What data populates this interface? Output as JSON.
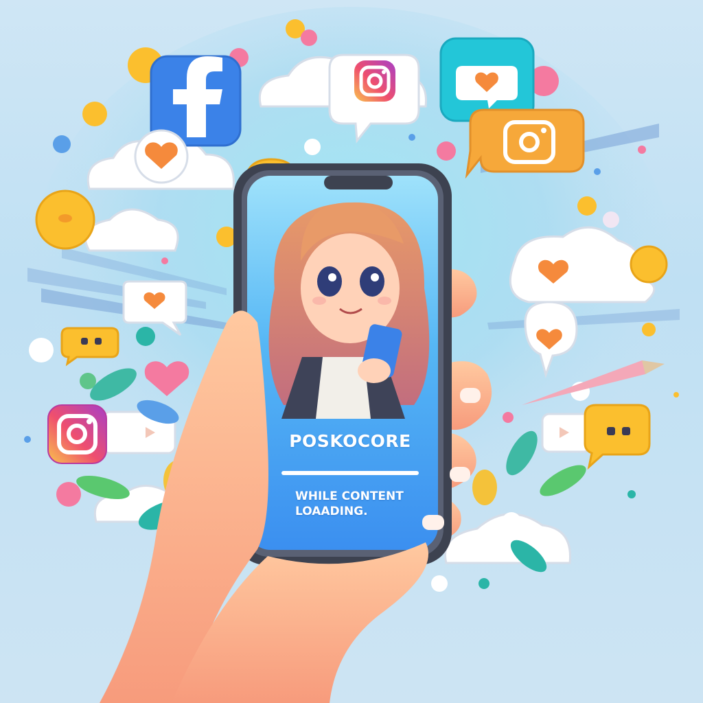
{
  "phone_screen": {
    "app_name": "POSKOCORE",
    "status_line_1": "WHILE CONTENT",
    "status_line_2": "LOAADING.",
    "loading_progress": 1.0
  },
  "icons": [
    "facebook-icon",
    "instagram-icon",
    "heart-icon",
    "chat-bubble-icon",
    "typing-dots-icon",
    "cloud-icon",
    "leaf-icon"
  ],
  "colors": {
    "background": "#c6e3f4",
    "phone_screen": "#3e9bf0",
    "facebook_blue": "#3b82e8",
    "instagram_gradient_start": "#f7b24a",
    "instagram_gradient_end": "#c23bb3",
    "chat_orange": "#f6a83a",
    "heart_orange": "#f58a3c",
    "heart_pink": "#f47aa0",
    "teal_bubble": "#23c6d8"
  }
}
